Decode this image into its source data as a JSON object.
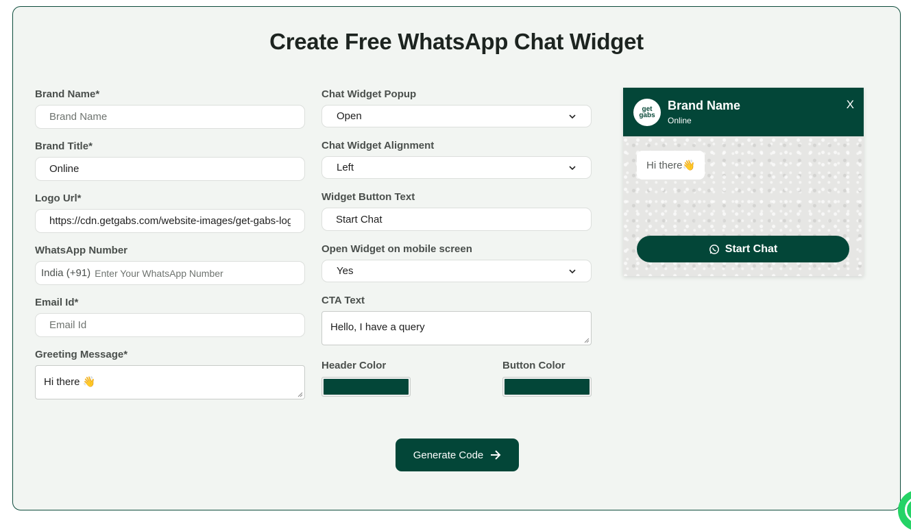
{
  "title": "Create Free WhatsApp Chat Widget",
  "colors": {
    "accent": "#034638",
    "header_color": "#034638",
    "button_color": "#034638"
  },
  "left": {
    "brand_name": {
      "label": "Brand Name*",
      "placeholder": "Brand Name",
      "value": ""
    },
    "brand_title": {
      "label": "Brand Title*",
      "value": "Online"
    },
    "logo_url": {
      "label": "Logo Url*",
      "value": "https://cdn.getgabs.com/website-images/get-gabs-logo.png"
    },
    "whatsapp_number": {
      "label": "WhatsApp Number",
      "country": "India (+91)",
      "placeholder": "Enter Your WhatsApp Number"
    },
    "email": {
      "label": "Email Id*",
      "placeholder": "Email Id"
    },
    "greeting": {
      "label": "Greeting Message*",
      "value": "Hi there 👋"
    }
  },
  "middle": {
    "popup": {
      "label": "Chat Widget Popup",
      "value": "Open"
    },
    "alignment": {
      "label": "Chat Widget Alignment",
      "value": "Left"
    },
    "button_text": {
      "label": "Widget Button Text",
      "value": "Start Chat"
    },
    "mobile": {
      "label": "Open Widget on mobile screen",
      "value": "Yes"
    },
    "cta": {
      "label": "CTA Text",
      "value": "Hello, I have a query"
    },
    "header_color_label": "Header Color",
    "button_color_label": "Button Color"
  },
  "generate_button": "Generate Code",
  "preview": {
    "logo_text_top": "get",
    "logo_text_bottom": "gabs",
    "brand_name": "Brand Name",
    "status": "Online",
    "close": "X",
    "greeting": "Hi there👋",
    "start_button": "Start Chat"
  },
  "icons": [
    "chevron-down-icon",
    "arrow-right-icon",
    "whatsapp-icon",
    "close-icon"
  ]
}
